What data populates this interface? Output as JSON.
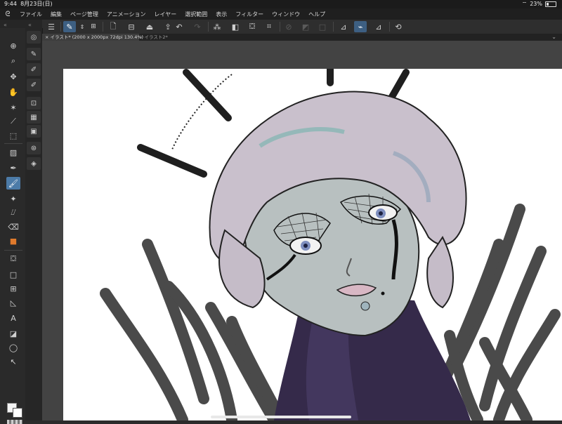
{
  "status": {
    "time": "9:44",
    "date": "8月23日(日)",
    "battery": "23%",
    "battery_level": 0.23
  },
  "menu": [
    "ファイル",
    "編集",
    "ページ管理",
    "アニメーション",
    "レイヤー",
    "選択範囲",
    "表示",
    "フィルター",
    "ウィンドウ",
    "ヘルプ"
  ],
  "tabs": [
    {
      "label": "イラスト* (2000 x 2000px 72dpi 130.4%)",
      "close": "×",
      "active": true
    },
    {
      "label": "イラスト2*",
      "close": "×",
      "active": false
    }
  ],
  "icons": {
    "menu": "menu-icon",
    "app_logo": "app-logo-icon",
    "wifi": "wifi-icon",
    "battery": "battery-icon"
  },
  "colors": {
    "accent": "#4c7ba8",
    "toolbar_active": "#3d5f82",
    "workspace": "#434343",
    "canvas": "#ffffff"
  }
}
